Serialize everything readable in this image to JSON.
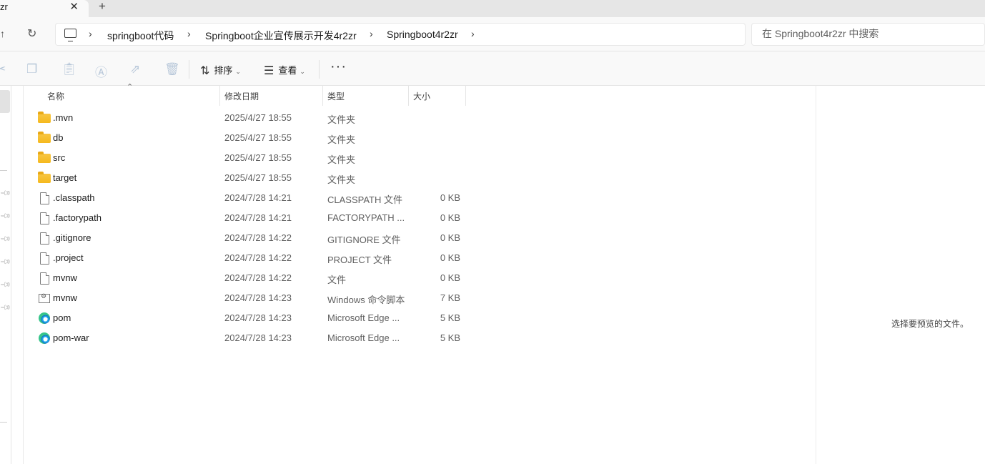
{
  "tab": {
    "title": "zr",
    "close": "✕",
    "new_tab": "+"
  },
  "address": {
    "breadcrumbs": [
      "springboot代码",
      "Springboot企业宣传展示开发4r2zr",
      "Springboot4r2zr"
    ],
    "separator": "›"
  },
  "search": {
    "placeholder": "在 Springboot4r2zr 中搜索"
  },
  "toolbar": {
    "sort_label": "排序",
    "view_label": "查看",
    "more_label": "···"
  },
  "columns": {
    "name": "名称",
    "date": "修改日期",
    "type": "类型",
    "size": "大小"
  },
  "files": [
    {
      "name": ".mvn",
      "date": "2025/4/27 18:55",
      "type": "文件夹",
      "size": "",
      "icon": "folder-icon"
    },
    {
      "name": "db",
      "date": "2025/4/27 18:55",
      "type": "文件夹",
      "size": "",
      "icon": "folder-icon"
    },
    {
      "name": "src",
      "date": "2025/4/27 18:55",
      "type": "文件夹",
      "size": "",
      "icon": "folder-icon"
    },
    {
      "name": "target",
      "date": "2025/4/27 18:55",
      "type": "文件夹",
      "size": "",
      "icon": "folder-icon"
    },
    {
      "name": ".classpath",
      "date": "2024/7/28 14:21",
      "type": "CLASSPATH 文件",
      "size": "0 KB",
      "icon": "file-icon"
    },
    {
      "name": ".factorypath",
      "date": "2024/7/28 14:21",
      "type": "FACTORYPATH ...",
      "size": "0 KB",
      "icon": "file-icon"
    },
    {
      "name": ".gitignore",
      "date": "2024/7/28 14:22",
      "type": "GITIGNORE 文件",
      "size": "0 KB",
      "icon": "file-icon"
    },
    {
      "name": ".project",
      "date": "2024/7/28 14:22",
      "type": "PROJECT 文件",
      "size": "0 KB",
      "icon": "file-icon"
    },
    {
      "name": "mvnw",
      "date": "2024/7/28 14:22",
      "type": "文件",
      "size": "0 KB",
      "icon": "file-icon"
    },
    {
      "name": "mvnw",
      "date": "2024/7/28 14:23",
      "type": "Windows 命令脚本",
      "size": "7 KB",
      "icon": "script-icon"
    },
    {
      "name": "pom",
      "date": "2024/7/28 14:23",
      "type": "Microsoft Edge ...",
      "size": "5 KB",
      "icon": "edge-icon"
    },
    {
      "name": "pom-war",
      "date": "2024/7/28 14:23",
      "type": "Microsoft Edge ...",
      "size": "5 KB",
      "icon": "edge-icon"
    }
  ],
  "preview": {
    "message": "选择要预览的文件。"
  }
}
